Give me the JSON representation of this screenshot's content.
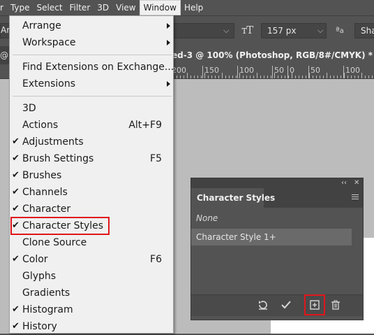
{
  "menubar": {
    "items": [
      "r",
      "Type",
      "Select",
      "Filter",
      "3D",
      "View",
      "Window",
      "Help"
    ],
    "active": "Window"
  },
  "options_bar": {
    "font_prefix": "Ar",
    "font_size": "157 px",
    "antialias_value": "Sha"
  },
  "doc_tab": {
    "left_glyph": "@",
    "title": "ed-3 @ 100% (Photoshop, RGB/8#/CMYK) *",
    "close": "×"
  },
  "ruler": {
    "numbers": [
      "200",
      "150",
      "100",
      "50",
      "0",
      "50",
      "100"
    ]
  },
  "window_menu": {
    "items": [
      {
        "label": "Arrange",
        "submenu": true
      },
      {
        "label": "Workspace",
        "submenu": true
      },
      {
        "separator": true
      },
      {
        "label": "Find Extensions on Exchange..."
      },
      {
        "label": "Extensions",
        "submenu": true
      },
      {
        "separator": true
      },
      {
        "label": "3D"
      },
      {
        "label": "Actions",
        "shortcut": "Alt+F9"
      },
      {
        "label": "Adjustments",
        "checked": true
      },
      {
        "label": "Brush Settings",
        "checked": true,
        "shortcut": "F5"
      },
      {
        "label": "Brushes",
        "checked": true
      },
      {
        "label": "Channels",
        "checked": true
      },
      {
        "label": "Character",
        "checked": true
      },
      {
        "label": "Character Styles",
        "checked": true,
        "highlighted": true
      },
      {
        "label": "Clone Source"
      },
      {
        "label": "Color",
        "checked": true,
        "shortcut": "F6"
      },
      {
        "label": "Glyphs"
      },
      {
        "label": "Gradients"
      },
      {
        "label": "Histogram",
        "checked": true
      },
      {
        "label": "History",
        "checked": true
      }
    ]
  },
  "character_styles_panel": {
    "title": "Character Styles",
    "collapse_glyph": "‹‹",
    "close_glyph": "✕",
    "items": [
      "None",
      "Character Style 1+"
    ],
    "selected": "Character Style 1+",
    "footer_icons": [
      "clear-override-icon",
      "redefine-style-icon",
      "new-style-icon",
      "delete-icon"
    ],
    "highlight_color": "#e0161c"
  }
}
